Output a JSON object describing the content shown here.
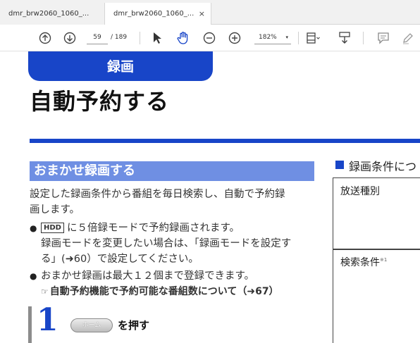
{
  "tabs": [
    {
      "label": "dmr_brw2060_1060_...",
      "active": false
    },
    {
      "label": "dmr_brw2060_1060_...",
      "active": true,
      "close": "×"
    }
  ],
  "toolbar": {
    "page_current": "59",
    "page_total": "/ 189",
    "zoom": "182%",
    "zoom_caret": "▾"
  },
  "document": {
    "tab_header": "録画",
    "title": "自動予約する",
    "section_title": "おまかせ録画する",
    "intro_line1": "設定した録画条件から番組を毎日検索し、自動で予約録",
    "intro_line2": "画します。",
    "bullet_symbol": "●",
    "bullet1_badge": "HDD",
    "bullet1_line1": "に５倍録モードで予約録画されます。",
    "bullet1_line2": "録画モードを変更したい場合は、「録画モードを設定す",
    "bullet1_line3": "る」(➜60）で設定してください。",
    "bullet2_line1": "おまかせ録画は最大１２個まで登録できます。",
    "bullet2_ref_icon": "☞",
    "bullet2_line2": "自動予約機能で予約可能な番組数について（➜67）",
    "step_number": "1",
    "home_button": "ホーム",
    "step_text": "を押す",
    "right_heading": "録画条件につ",
    "table_row1": "放送種別",
    "table_row2": "検索条件",
    "table_row2_note": "※1"
  },
  "colors": {
    "brand_blue": "#1845c8",
    "section_blue": "#6f8fe3"
  }
}
